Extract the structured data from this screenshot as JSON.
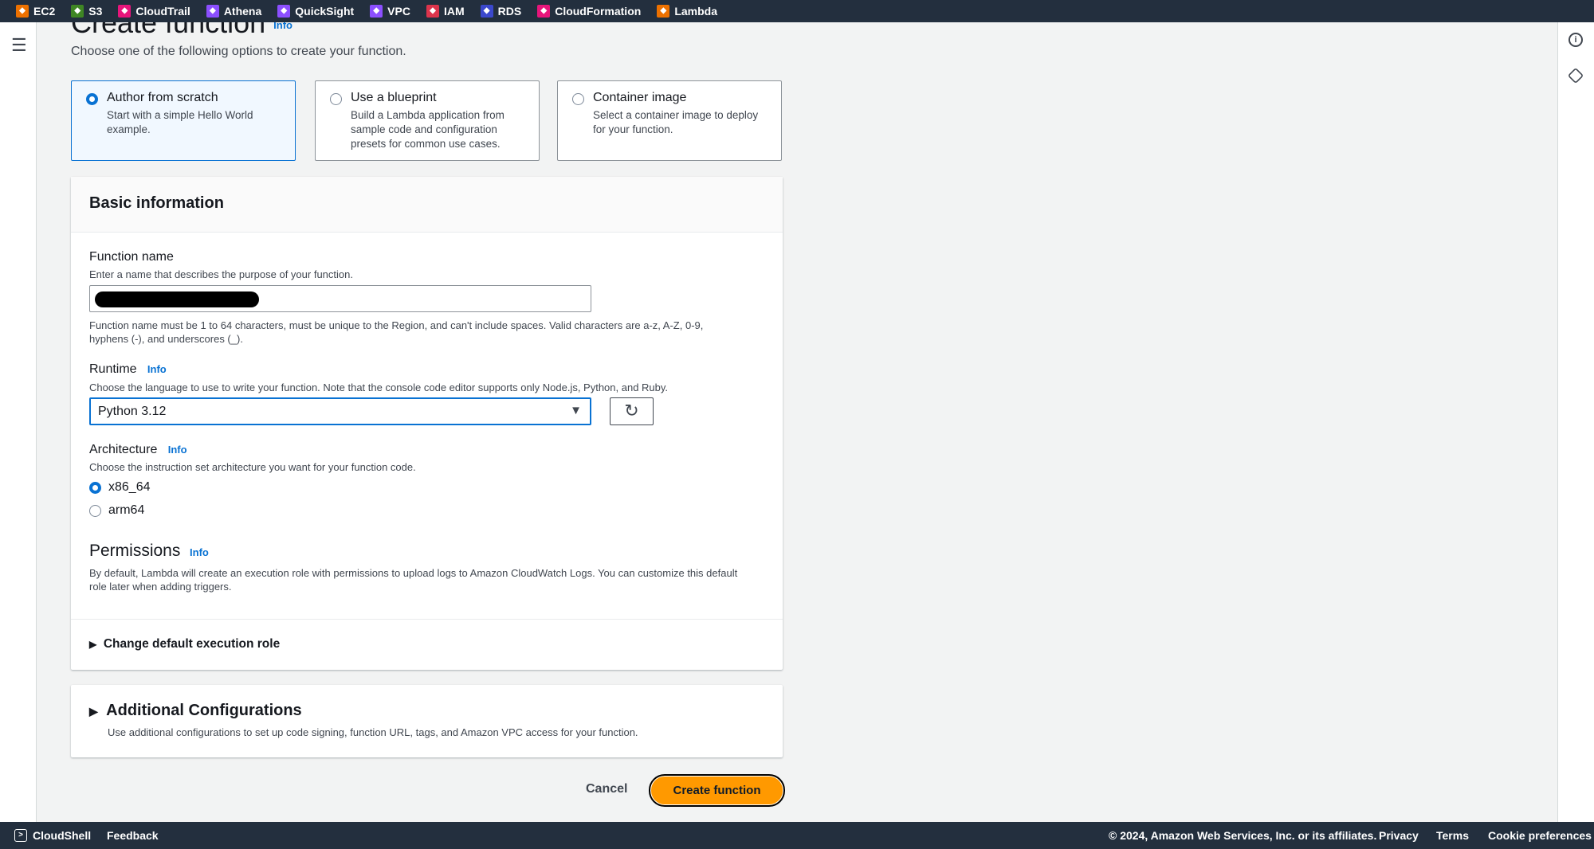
{
  "topbar": {
    "services": [
      {
        "label": "EC2",
        "color": "#ed7100"
      },
      {
        "label": "S3",
        "color": "#3f8624"
      },
      {
        "label": "CloudTrail",
        "color": "#e7157b"
      },
      {
        "label": "Athena",
        "color": "#8c4fff"
      },
      {
        "label": "QuickSight",
        "color": "#8c4fff"
      },
      {
        "label": "VPC",
        "color": "#8c4fff"
      },
      {
        "label": "IAM",
        "color": "#dd344c"
      },
      {
        "label": "RDS",
        "color": "#3b48cc"
      },
      {
        "label": "CloudFormation",
        "color": "#e7157b"
      },
      {
        "label": "Lambda",
        "color": "#ed7100"
      }
    ]
  },
  "page": {
    "title": "Create function",
    "info": "Info",
    "subtitle": "Choose one of the following options to create your function."
  },
  "options": [
    {
      "title": "Author from scratch",
      "desc": "Start with a simple Hello World example.",
      "selected": true
    },
    {
      "title": "Use a blueprint",
      "desc": "Build a Lambda application from sample code and configuration presets for common use cases.",
      "selected": false
    },
    {
      "title": "Container image",
      "desc": "Select a container image to deploy for your function.",
      "selected": false
    }
  ],
  "basic": {
    "header": "Basic information",
    "function_name": {
      "label": "Function name",
      "desc": "Enter a name that describes the purpose of your function.",
      "value": "",
      "help": "Function name must be 1 to 64 characters, must be unique to the Region, and can't include spaces. Valid characters are a-z, A-Z, 0-9, hyphens (-), and underscores (_)."
    },
    "runtime": {
      "label": "Runtime",
      "info": "Info",
      "desc": "Choose the language to use to write your function. Note that the console code editor supports only Node.js, Python, and Ruby.",
      "value": "Python 3.12"
    },
    "architecture": {
      "label": "Architecture",
      "info": "Info",
      "desc": "Choose the instruction set architecture you want for your function code.",
      "options": [
        "x86_64",
        "arm64"
      ],
      "selected": "x86_64"
    },
    "permissions": {
      "label": "Permissions",
      "info": "Info",
      "desc": "By default, Lambda will create an execution role with permissions to upload logs to Amazon CloudWatch Logs. You can customize this default role later when adding triggers."
    },
    "change_role": "Change default execution role"
  },
  "additional": {
    "title": "Additional Configurations",
    "desc": "Use additional configurations to set up code signing, function URL, tags, and Amazon VPC access for your function."
  },
  "actions": {
    "cancel": "Cancel",
    "create": "Create function"
  },
  "footer": {
    "cloudshell": "CloudShell",
    "feedback": "Feedback",
    "copyright": "© 2024, Amazon Web Services, Inc. or its affiliates.",
    "privacy": "Privacy",
    "terms": "Terms",
    "cookies": "Cookie preferences"
  }
}
